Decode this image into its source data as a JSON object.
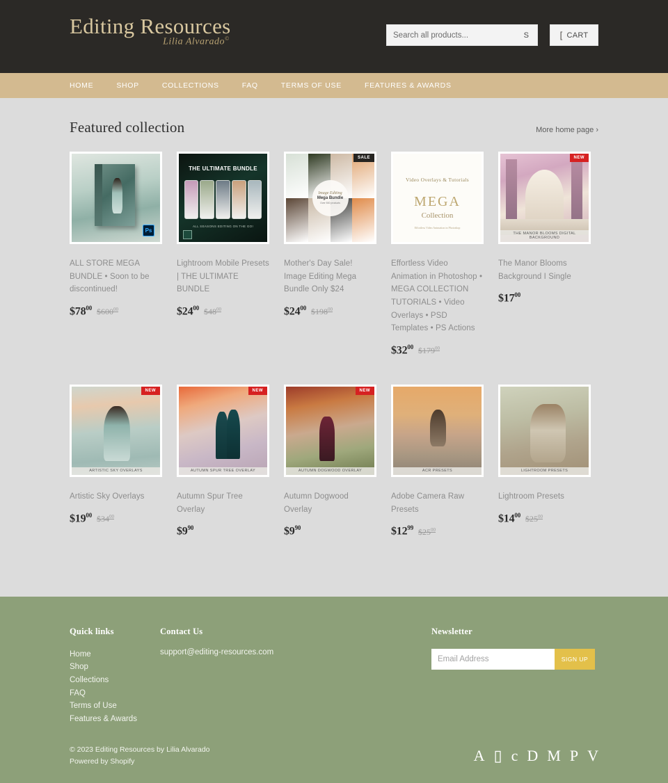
{
  "header": {
    "logo_main": "Editing Resources",
    "logo_sub": "Lilia Alvarado",
    "logo_sub_mark": "©",
    "search_placeholder": "Search all products...",
    "search_value": "",
    "search_submit_label": "S",
    "cart_label": "CART",
    "cart_icon": "shopping-cart-icon",
    "bg_color": "#2b2926"
  },
  "nav": {
    "bg_color": "#d3ba90",
    "items": [
      {
        "label": "HOME"
      },
      {
        "label": "SHOP"
      },
      {
        "label": "COLLECTIONS"
      },
      {
        "label": "FAQ"
      },
      {
        "label": "TERMS OF USE"
      },
      {
        "label": "FEATURES & AWARDS"
      }
    ]
  },
  "main": {
    "section_title": "Featured collection",
    "more_link": "More home page ›",
    "products": [
      {
        "title": "ALL STORE MEGA BUNDLE • Soon to be discontinued!",
        "price": "$78",
        "price_cents": "00",
        "compare_price": "$600",
        "compare_cents": "00",
        "badge": "",
        "caption": "",
        "art": "all-store-mega-bundle"
      },
      {
        "title": "Lightroom Mobile Presets | THE ULTIMATE BUNDLE",
        "price": "$24",
        "price_cents": "00",
        "compare_price": "$48",
        "compare_cents": "00",
        "badge": "",
        "caption": "ALL SEASONS EDITING ON THE GO!",
        "image_title": "THE ULTIMATE BUNDLE",
        "art": "ultimate-bundle"
      },
      {
        "title": "Mother's Day Sale! Image Editing Mega Bundle Only $24",
        "price": "$24",
        "price_cents": "00",
        "compare_price": "$198",
        "compare_cents": "00",
        "badge": "SALE",
        "badge_type": "sale",
        "circle_line1": "Image Editing",
        "circle_line2": "Mega Bundle",
        "circle_line3": "Over 500 products",
        "art": "mothers-day-collage"
      },
      {
        "title": "Effortless Video Animation in Photoshop • MEGA COLLECTION TUTORIALS • Video Overlays • PSD Templates • PS Actions",
        "price": "$32",
        "price_cents": "00",
        "compare_price": "$179",
        "compare_cents": "00",
        "badge": "",
        "image_top": "Video Overlays & Tutorials",
        "image_main": "MEGA",
        "image_sub": "Collection",
        "image_foot": "Effortless Video Animation in Photoshop",
        "art": "mega-collection"
      },
      {
        "title": "The Manor Blooms Background I Single",
        "price": "$17",
        "price_cents": "00",
        "compare_price": "",
        "compare_cents": "",
        "badge": "NEW",
        "badge_type": "new",
        "caption": "THE MANOR BLOOMS DIGITAL BACKGROUND",
        "art": "manor-blooms"
      },
      {
        "title": "Artistic Sky Overlays",
        "price": "$19",
        "price_cents": "00",
        "compare_price": "$34",
        "compare_cents": "00",
        "badge": "NEW",
        "badge_type": "new",
        "caption": "ARTISTIC SKY OVERLAYS",
        "art": "artistic-sky"
      },
      {
        "title": "Autumn Spur Tree Overlay",
        "price": "$9",
        "price_cents": "90",
        "compare_price": "",
        "compare_cents": "",
        "badge": "NEW",
        "badge_type": "new",
        "caption": "AUTUMN SPUR TREE OVERLAY",
        "art": "autumn-spur"
      },
      {
        "title": "Autumn Dogwood Overlay",
        "price": "$9",
        "price_cents": "90",
        "compare_price": "",
        "compare_cents": "",
        "badge": "NEW",
        "badge_type": "new",
        "caption": "AUTUMN DOGWOOD OVERLAY",
        "art": "autumn-dogwood"
      },
      {
        "title": "Adobe Camera Raw Presets",
        "price": "$12",
        "price_cents": "99",
        "compare_price": "$25",
        "compare_cents": "00",
        "badge": "",
        "caption": "ACR PRESETS",
        "art": "acr-presets"
      },
      {
        "title": "Lightroom Presets",
        "price": "$14",
        "price_cents": "00",
        "compare_price": "$25",
        "compare_cents": "00",
        "badge": "",
        "caption": "LIGHTROOM PRESETS",
        "art": "lightroom-presets"
      }
    ]
  },
  "footer": {
    "bg_color": "#8da079",
    "quick_links_title": "Quick links",
    "quick_links": [
      {
        "label": "Home"
      },
      {
        "label": "Shop"
      },
      {
        "label": "Collections"
      },
      {
        "label": "FAQ"
      },
      {
        "label": "Terms of Use"
      },
      {
        "label": "Features & Awards"
      }
    ],
    "contact_title": "Contact Us",
    "contact_email": "support@editing-resources.com",
    "newsletter_title": "Newsletter",
    "newsletter_placeholder": "Email Address",
    "newsletter_value": "",
    "newsletter_button": "SIGN UP",
    "newsletter_button_color": "#e3c04a",
    "copyright": "© 2023 Editing Resources by Lilia Alvarado",
    "powered_by": "Powered by Shopify",
    "payment_icons": [
      {
        "glyph": "A",
        "name": "amex-icon"
      },
      {
        "glyph": "▯",
        "name": "apple-pay-icon"
      },
      {
        "glyph": "c",
        "name": "diners-club-icon"
      },
      {
        "glyph": "D",
        "name": "discover-icon"
      },
      {
        "glyph": "M",
        "name": "mastercard-icon"
      },
      {
        "glyph": "P",
        "name": "paypal-icon"
      },
      {
        "glyph": "V",
        "name": "visa-icon"
      }
    ]
  }
}
